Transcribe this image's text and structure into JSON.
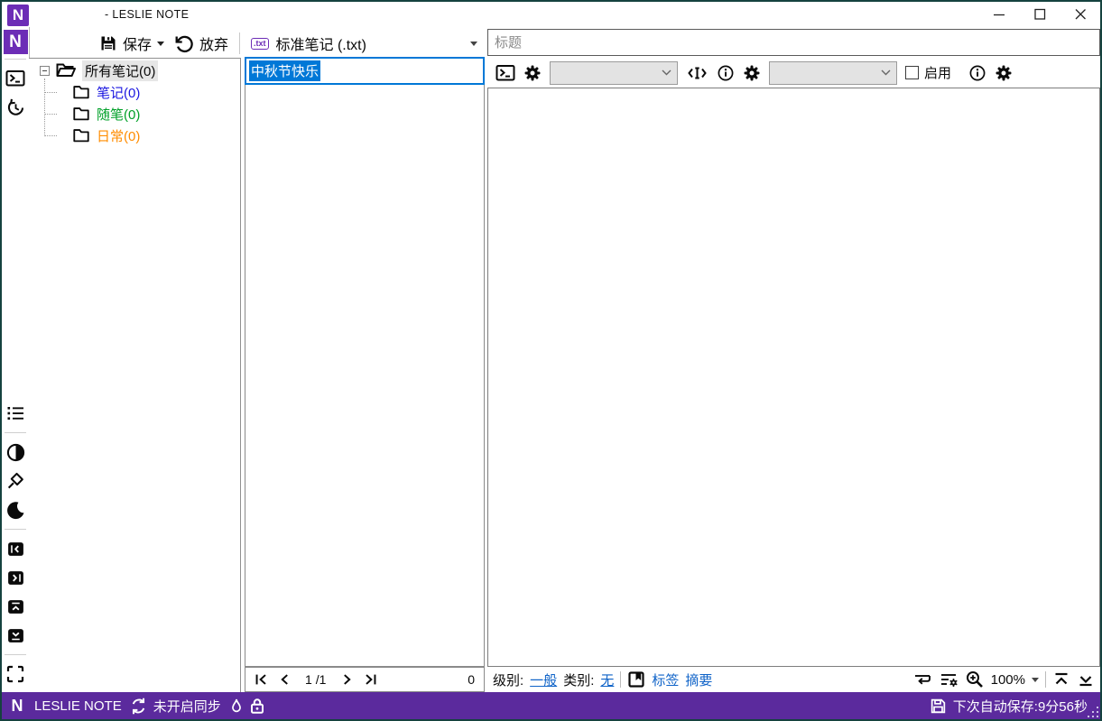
{
  "window": {
    "title": "- LESLIE NOTE"
  },
  "colors": {
    "accent_purple": "#5B2A9D",
    "logo_purple": "#6C2DB6",
    "selection_blue": "#0078D7",
    "link_blue": "#0F63C8",
    "folder_blue": "#1B17E0",
    "folder_green": "#00A028",
    "folder_orange": "#FF8C00",
    "window_border": "#15423F"
  },
  "toolbar": {
    "save_label": "保存",
    "discard_label": "放弃",
    "txt_badge": ".txt",
    "note_type_label": "标准笔记 (.txt)"
  },
  "tree": {
    "root_label": "所有笔记(0)",
    "folders": [
      {
        "label": "笔记(0)",
        "color": "#1B17E0"
      },
      {
        "label": "随笔(0)",
        "color": "#00A028"
      },
      {
        "label": "日常(0)",
        "color": "#FF8C00"
      }
    ]
  },
  "note_list": {
    "selected_note_title": "中秋节快乐"
  },
  "pager": {
    "page_current": "1",
    "page_total": "/1",
    "note_count": "0"
  },
  "editor": {
    "title_placeholder": "标题",
    "enable_label": "启用",
    "zoom_level": "100%"
  },
  "footer": {
    "level_label": "级别:",
    "level_value": "一般",
    "category_label": "类别:",
    "category_value": "无",
    "tags_label": "标签",
    "summary_label": "摘要"
  },
  "statusbar": {
    "app_name": "LESLIE NOTE",
    "sync_status": "未开启同步",
    "autosave_text": "下次自动保存:9分56秒"
  },
  "icons": {
    "app_logo": "letter-N-on-purple",
    "save": "floppy-disk",
    "discard": "undo-arrow",
    "note_type": "txt-badge",
    "rail_top": [
      "terminal",
      "history-clock"
    ],
    "rail_bottom": [
      "list",
      "contrast",
      "pin",
      "moon",
      "panel-left",
      "panel-right",
      "panel-up",
      "panel-down",
      "fullscreen"
    ],
    "editor_toolbar": [
      "terminal",
      "gear",
      "combo",
      "cursor-brackets",
      "info",
      "gear",
      "combo",
      "checkbox",
      "info",
      "gear"
    ],
    "pager_icons": [
      "first-page",
      "prev-page",
      "next-page",
      "last-page"
    ],
    "footer_icons": [
      "bookmark",
      "word-wrap",
      "wrap-settings",
      "zoom-in",
      "scroll-top",
      "scroll-bottom"
    ],
    "statusbar_icons": [
      "sync",
      "flame",
      "lock",
      "floppy-disk",
      "resize-grip"
    ]
  }
}
